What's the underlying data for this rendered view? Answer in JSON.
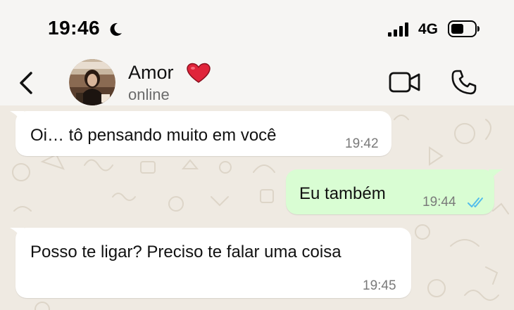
{
  "status_bar": {
    "time": "19:46",
    "moon_icon": "moon-icon",
    "signal_icon": "signal-icon",
    "network": "4G",
    "battery_icon": "battery-icon"
  },
  "header": {
    "back_icon": "chevron-left-icon",
    "contact_name": "Amor",
    "heart_icon": "heart-icon",
    "contact_status": "online",
    "video_icon": "video-call-icon",
    "call_icon": "phone-icon"
  },
  "colors": {
    "incoming_bubble": "#ffffff",
    "outgoing_bubble": "#d9fdd3",
    "read_ticks": "#53bdeb",
    "heart": "#e0243a",
    "chat_background": "#efeae2"
  },
  "messages": [
    {
      "direction": "incoming",
      "text": "Oi… tô pensando muito em você",
      "time": "19:42"
    },
    {
      "direction": "outgoing",
      "text": "Eu também",
      "time": "19:44",
      "status_icon": "double-check-icon"
    },
    {
      "direction": "incoming",
      "text": "Posso te ligar? Preciso te falar uma coisa",
      "time": "19:45"
    }
  ]
}
